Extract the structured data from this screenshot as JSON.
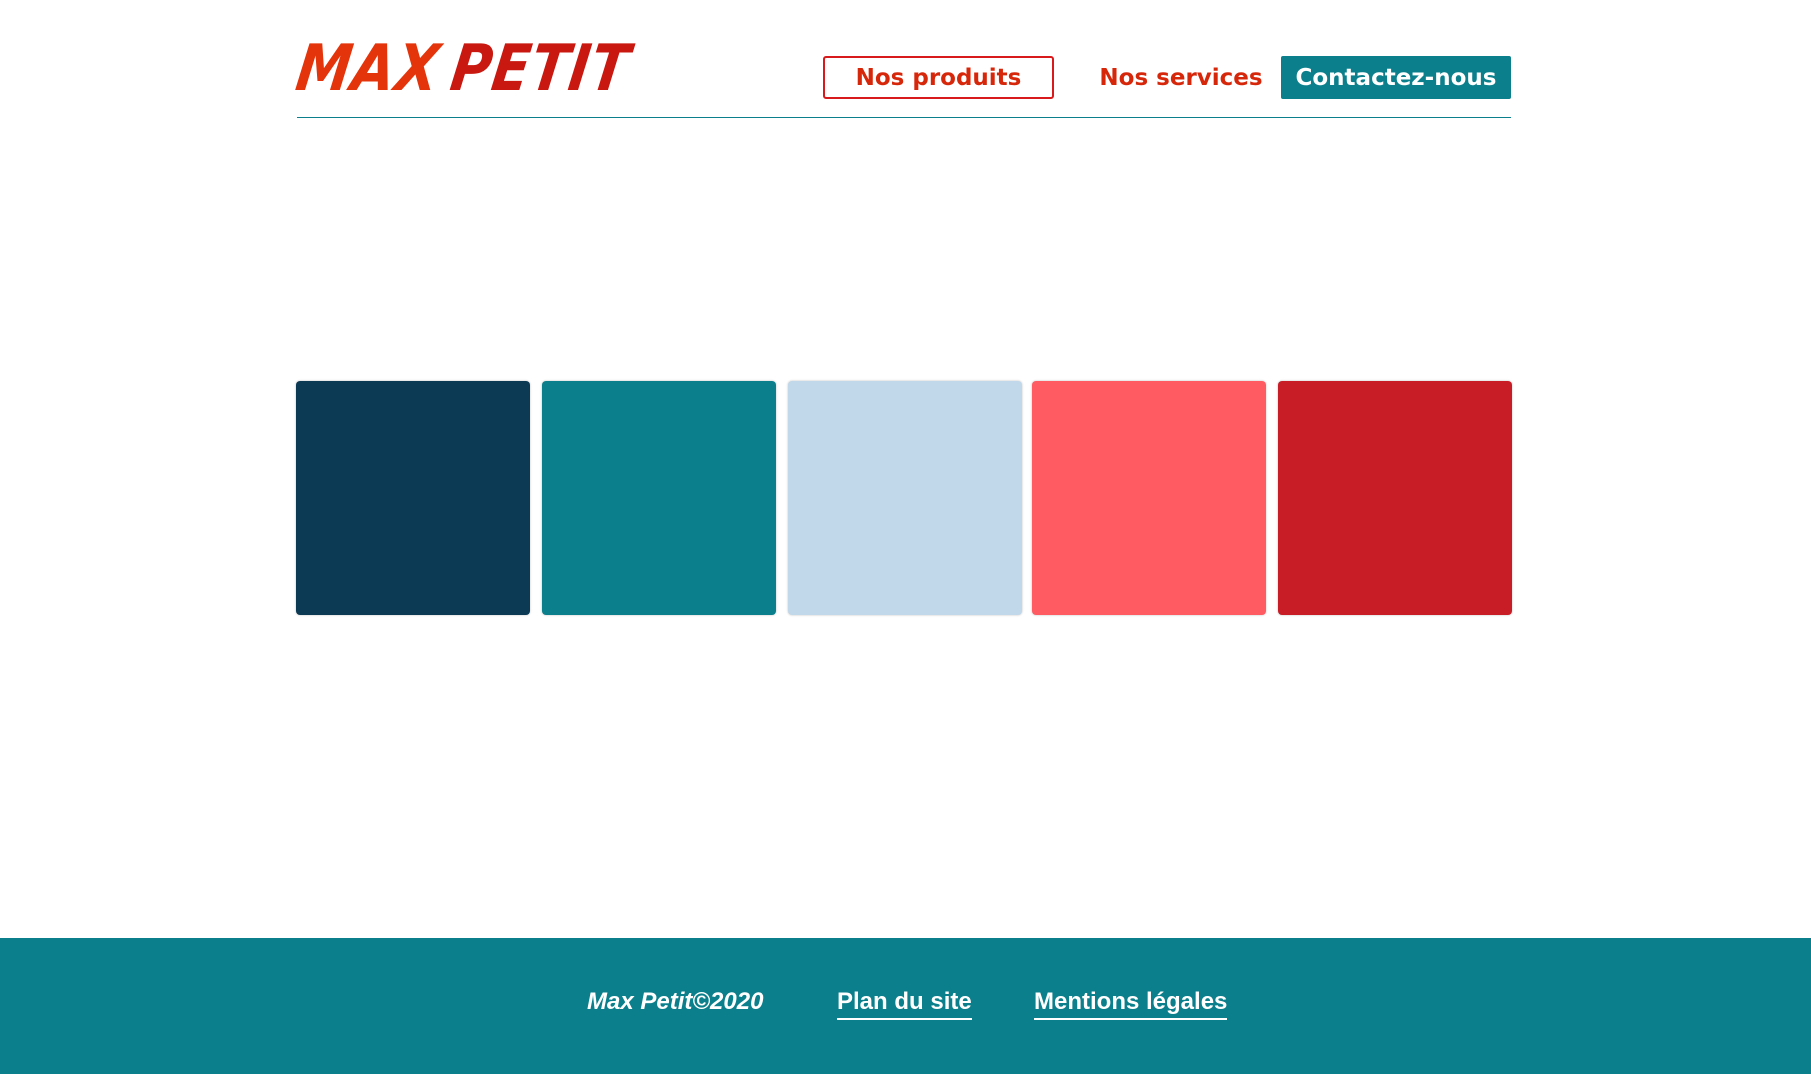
{
  "header": {
    "logo": {
      "word1": "MAX",
      "word2": "PETIT"
    },
    "nav": {
      "produits": "Nos produits",
      "services": "Nos services",
      "contact": "Contactez-nous"
    }
  },
  "palette": {
    "swatches": [
      {
        "color": "#0c3a54"
      },
      {
        "color": "#0b7f8b"
      },
      {
        "color": "#c1d7ea"
      },
      {
        "color": "#ff5b63"
      },
      {
        "color": "#c81d27"
      }
    ]
  },
  "colors": {
    "accent_red": "#d7270b",
    "accent_teal": "#0b7f8b",
    "background": "#ffffff"
  },
  "footer": {
    "copyright": "Max Petit©2020",
    "plan": "Plan du site",
    "mentions": "Mentions légales"
  }
}
